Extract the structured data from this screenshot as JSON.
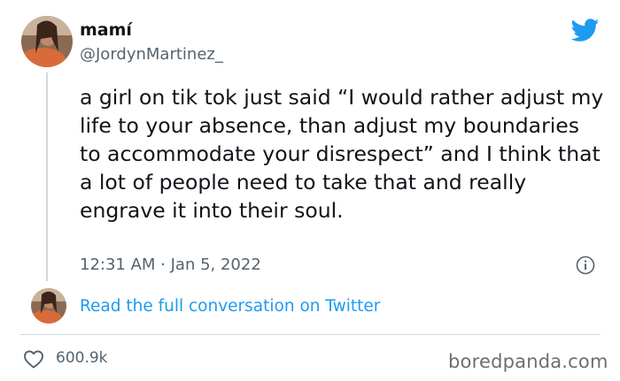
{
  "tweet": {
    "display_name": "mamí",
    "handle": "@JordynMartinez_",
    "text": "a girl on tik tok just said “I would rather adjust my life to your absence, than adjust my boundaries to accommodate your disrespect” and I think that a lot of people need to take that and really engrave it into their soul.",
    "timestamp": "12:31 AM · Jan 5, 2022",
    "read_conversation": "Read the full conversation on Twitter",
    "like_count": "600.9k"
  },
  "icons": {
    "logo": "twitter-bird-icon",
    "info": "info-icon",
    "like": "heart-icon"
  },
  "colors": {
    "twitter_blue": "#1d9bf0",
    "secondary_text": "#536471",
    "primary_text": "#0f1419"
  },
  "watermark": "boredpanda.com"
}
